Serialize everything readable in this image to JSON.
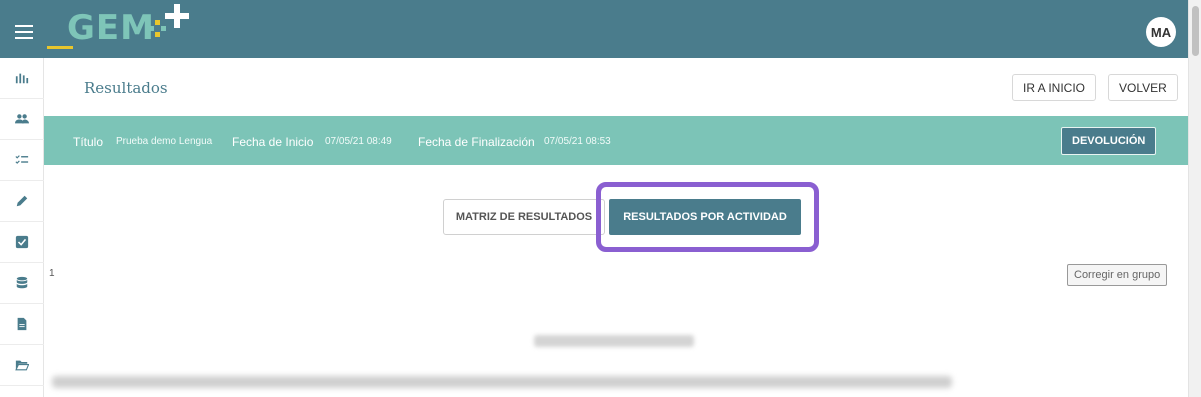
{
  "brand": {
    "logo_text": "GEM",
    "accent_color": "#4a7c8c",
    "teal_color": "#7cc4b7",
    "highlight_color": "#8a5fd1"
  },
  "user": {
    "initials": "MA"
  },
  "sidebar": {
    "items": [
      {
        "icon": "stats-icon"
      },
      {
        "icon": "users-icon"
      },
      {
        "icon": "checklist-icon"
      },
      {
        "icon": "pencil-icon"
      },
      {
        "icon": "checkbox-icon"
      },
      {
        "icon": "database-icon"
      },
      {
        "icon": "document-icon"
      },
      {
        "icon": "folder-open-icon"
      }
    ]
  },
  "header": {
    "title": "Resultados",
    "go_home_label": "IR A INICIO",
    "back_label": "VOLVER"
  },
  "info": {
    "title_label": "Título",
    "title_value": "Prueba demo Lengua",
    "start_label": "Fecha de Inicio",
    "start_value": "07/05/21 08:49",
    "end_label": "Fecha de Finalización",
    "end_value": "07/05/21 08:53",
    "return_label": "DEVOLUCIÓN"
  },
  "tabs": {
    "matrix_label": "MATRIZ DE RESULTADOS",
    "by_activity_label": "RESULTADOS POR ACTIVIDAD"
  },
  "content": {
    "item_number": "1",
    "group_correct_label": "Corregir en grupo"
  }
}
